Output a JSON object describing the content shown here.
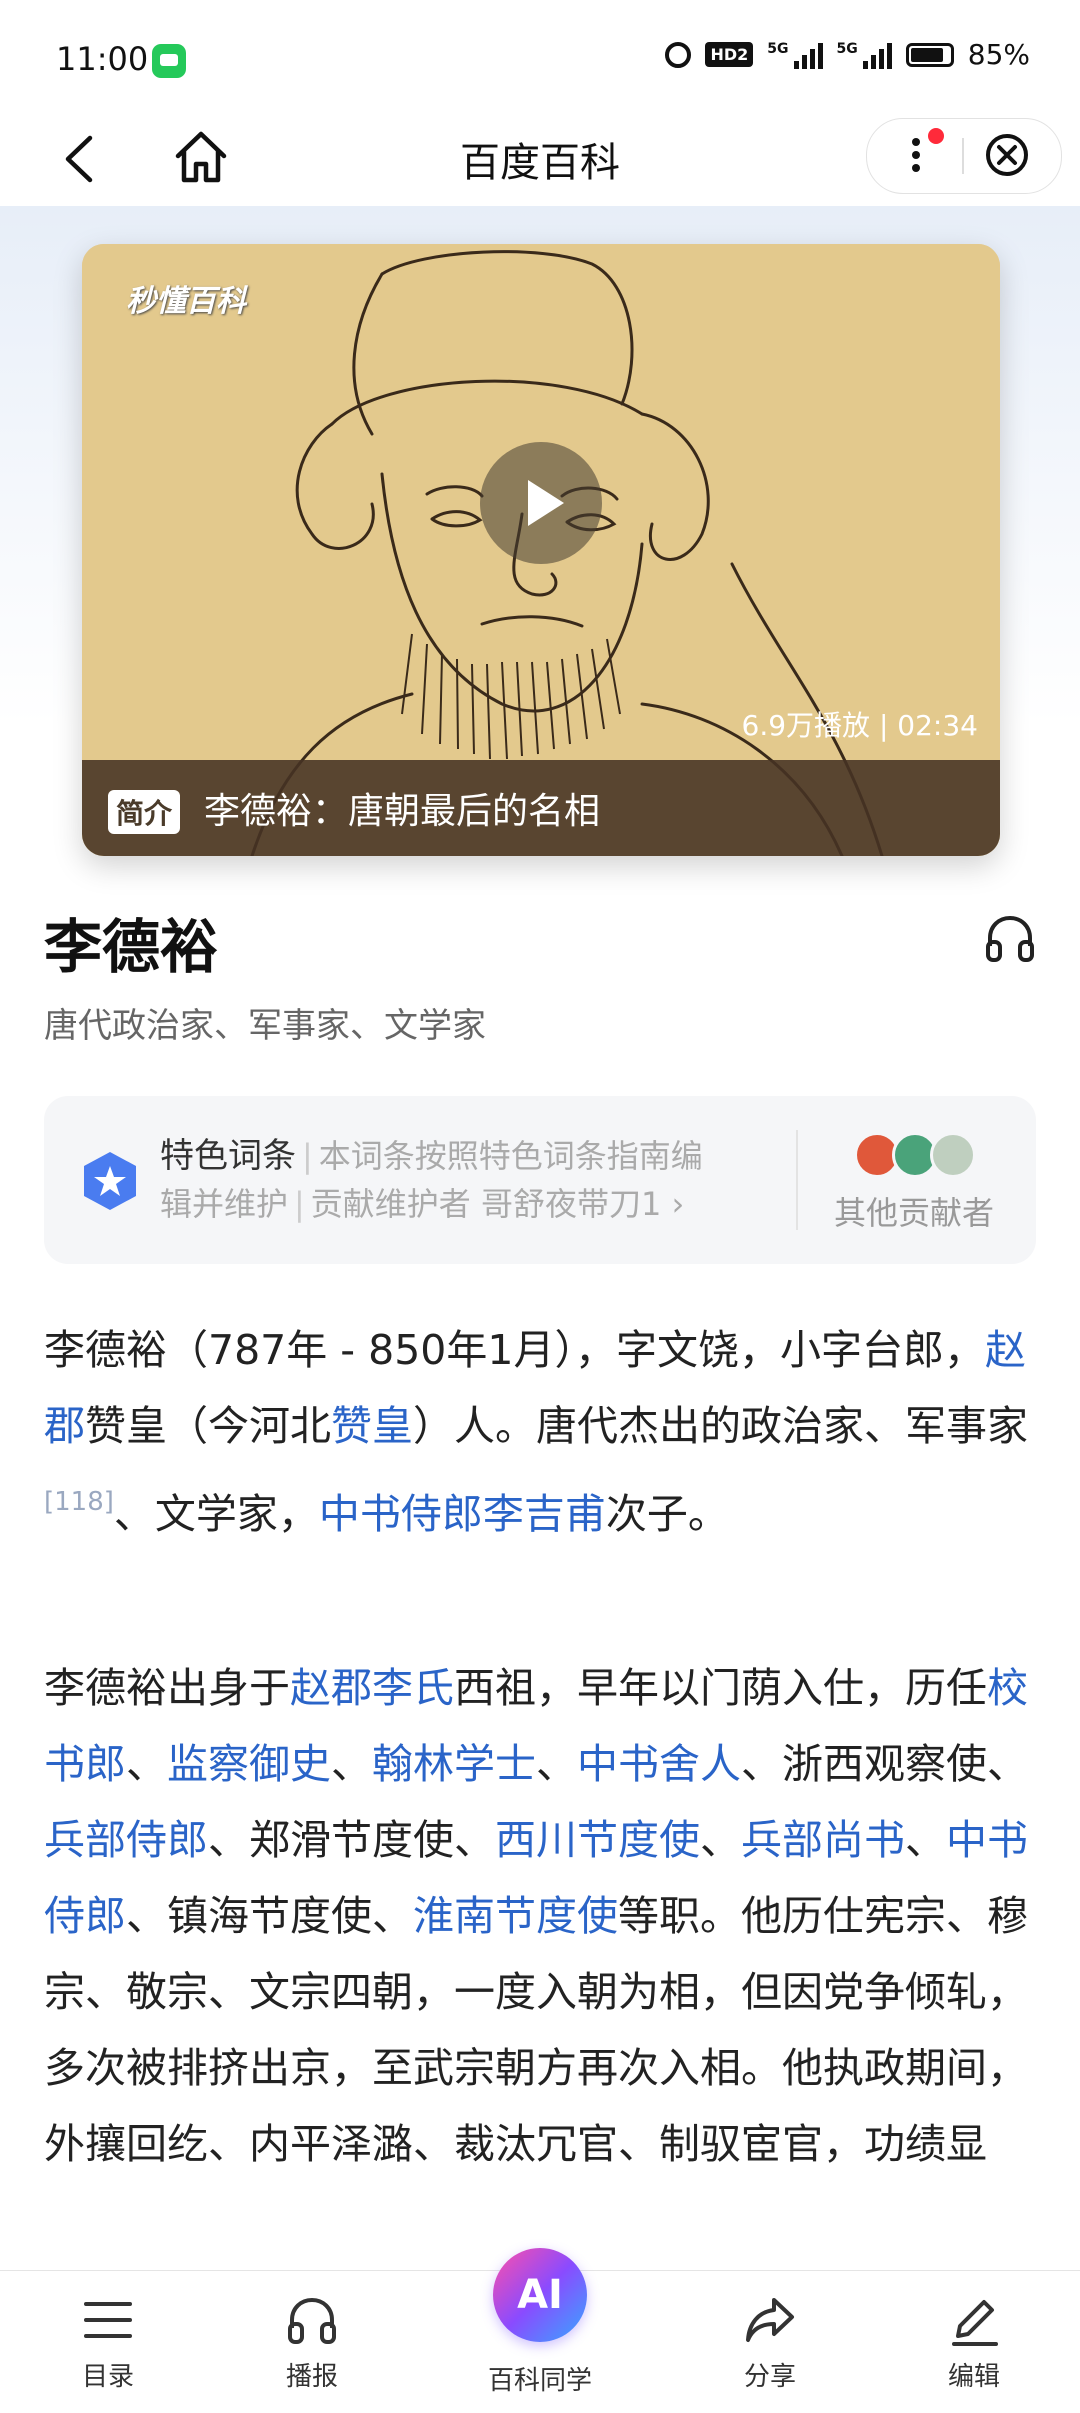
{
  "status_bar": {
    "time": "11:00",
    "hd_label": "HD2",
    "network_1": "5G",
    "network_2": "5G",
    "battery_text": "85%",
    "battery_level": 0.85
  },
  "nav": {
    "title": "百度百科"
  },
  "video": {
    "logo": "秒懂百科",
    "stats": "6.9万播放 | 02:34",
    "badge": "简介",
    "title": "李德裕：唐朝最后的名相"
  },
  "entry": {
    "title": "李德裕",
    "subtitle": "唐代政治家、军事家、文学家"
  },
  "featured_card": {
    "label": "特色词条",
    "line1_rest": "本词条按照特色词条指南编",
    "line2_part1": "辑并维护",
    "line2_part2": "贡献维护者 哥舒夜带刀1",
    "chevron": "›",
    "other_contributors": "其他贡献者"
  },
  "article": {
    "p1": {
      "t1": "李德裕（787年 - 850年1月），字文饶，小字台郎，",
      "l1": "赵郡",
      "t2": "赞皇（今河北",
      "l2": "赞皇",
      "t3": "）人。唐代杰出的政治家、军事家",
      "ref": "[118]",
      "t4": "、文学家，",
      "l3": "中书侍郎李吉甫",
      "t5": "次子。"
    },
    "p2": {
      "t1": "李德裕出身于",
      "l1": "赵郡李氏",
      "t2": "西祖，早年以门荫入仕，历任",
      "l2": "校书郎",
      "s1": "、",
      "l3": "监察御史",
      "s2": "、",
      "l4": "翰林学士",
      "s3": "、",
      "l5": "中书舍人",
      "t3": "、浙西观察使、",
      "l6": "兵部侍郎",
      "t4": "、郑滑节度使、",
      "l7": "西川节度使",
      "s4": "、",
      "l8": "兵部尚书",
      "s5": "、",
      "l9": "中书侍郎",
      "t5": "、镇海节度使、",
      "l10": "淮南节度使",
      "t6": "等职。他历仕宪宗、穆宗、敬宗、文宗四朝，一度入朝为相，但因党争倾轧，多次被排挤出京，至武宗朝方再次入相。他执政期间，外攘回纥、内平泽潞、裁汰冗官、制驭宦官，功绩显"
    }
  },
  "bottom_bar": {
    "toc": "目录",
    "broadcast": "播报",
    "ai_icon_text": "AI",
    "ai": "百科同学",
    "share": "分享",
    "edit": "编辑"
  },
  "colors": {
    "link": "#2a64c8",
    "accent_red": "#ff2a3a",
    "featured_icon": "#4a7cf0"
  }
}
